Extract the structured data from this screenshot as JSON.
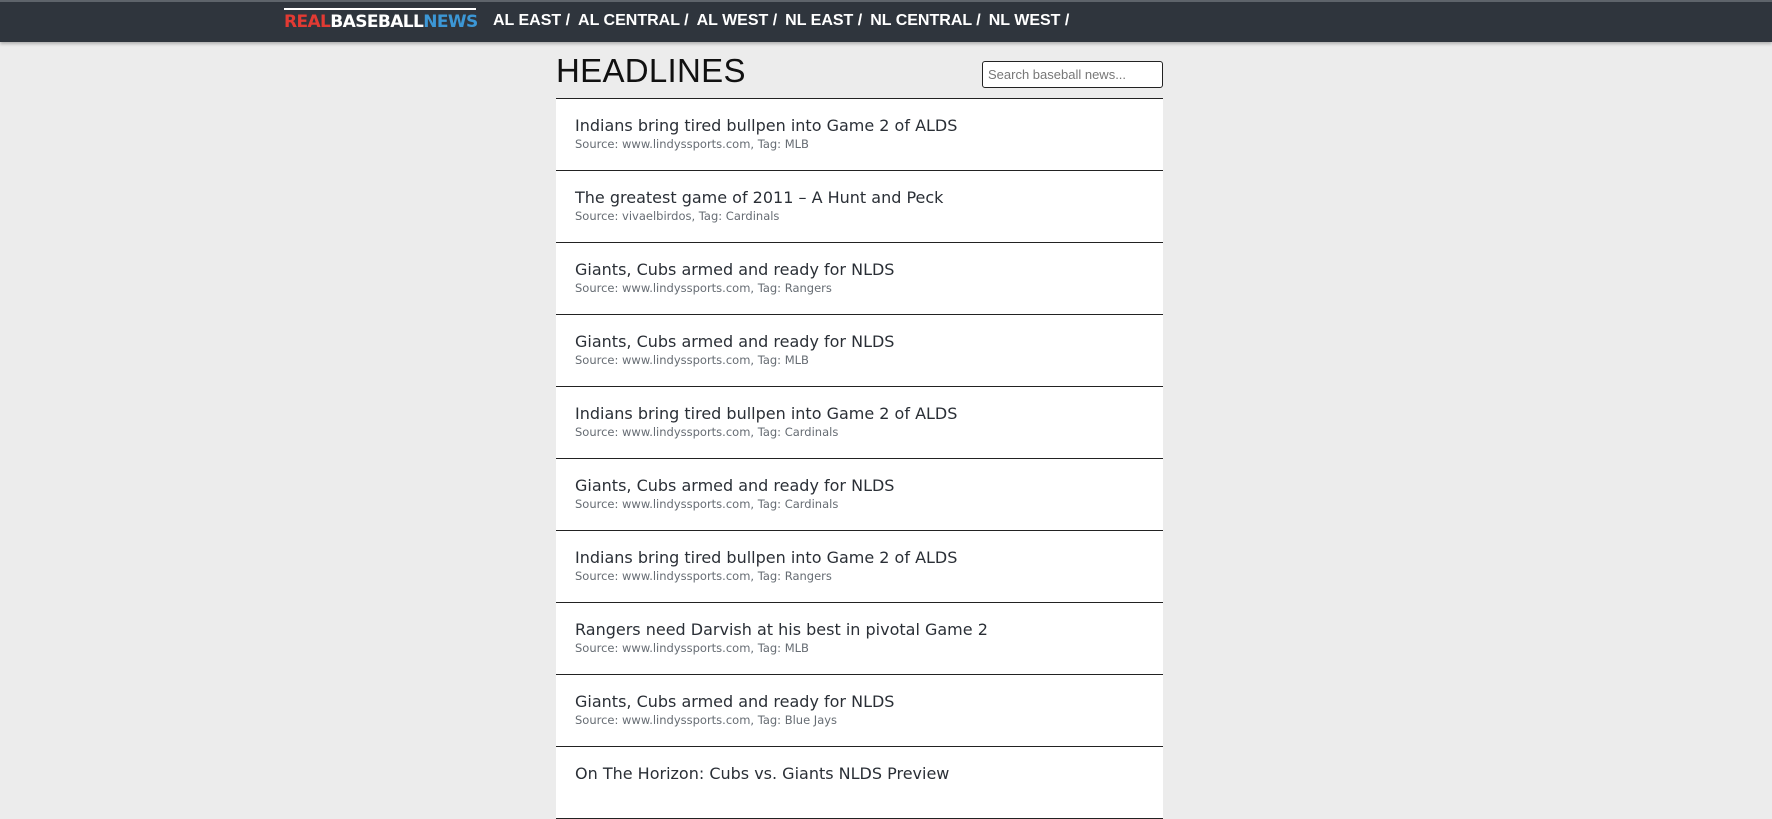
{
  "brand": {
    "real": "REAL",
    "baseball": "BASEBALL",
    "news": "NEWS"
  },
  "nav": [
    {
      "label": "AL EAST /"
    },
    {
      "label": "AL CENTRAL /"
    },
    {
      "label": "AL WEST /"
    },
    {
      "label": "NL EAST /"
    },
    {
      "label": "NL CENTRAL /"
    },
    {
      "label": "NL WEST /"
    }
  ],
  "page": {
    "title": "HEADLINES"
  },
  "search": {
    "placeholder": "Search baseball news..."
  },
  "articles": [
    {
      "title": "Indians bring tired bullpen into Game 2 of ALDS",
      "meta": "Source: www.lindyssports.com, Tag: MLB"
    },
    {
      "title": "The greatest game of 2011 – A Hunt and Peck",
      "meta": "Source: vivaelbirdos, Tag: Cardinals"
    },
    {
      "title": "Giants, Cubs armed and ready for NLDS",
      "meta": "Source: www.lindyssports.com, Tag: Rangers"
    },
    {
      "title": "Giants, Cubs armed and ready for NLDS",
      "meta": "Source: www.lindyssports.com, Tag: MLB"
    },
    {
      "title": "Indians bring tired bullpen into Game 2 of ALDS",
      "meta": "Source: www.lindyssports.com, Tag: Cardinals"
    },
    {
      "title": "Giants, Cubs armed and ready for NLDS",
      "meta": "Source: www.lindyssports.com, Tag: Cardinals"
    },
    {
      "title": "Indians bring tired bullpen into Game 2 of ALDS",
      "meta": "Source: www.lindyssports.com, Tag: Rangers"
    },
    {
      "title": "Rangers need Darvish at his best in pivotal Game 2",
      "meta": "Source: www.lindyssports.com, Tag: MLB"
    },
    {
      "title": "Giants, Cubs armed and ready for NLDS",
      "meta": "Source: www.lindyssports.com, Tag: Blue Jays"
    },
    {
      "title": "On The Horizon: Cubs vs. Giants NLDS Preview",
      "meta": ""
    }
  ]
}
